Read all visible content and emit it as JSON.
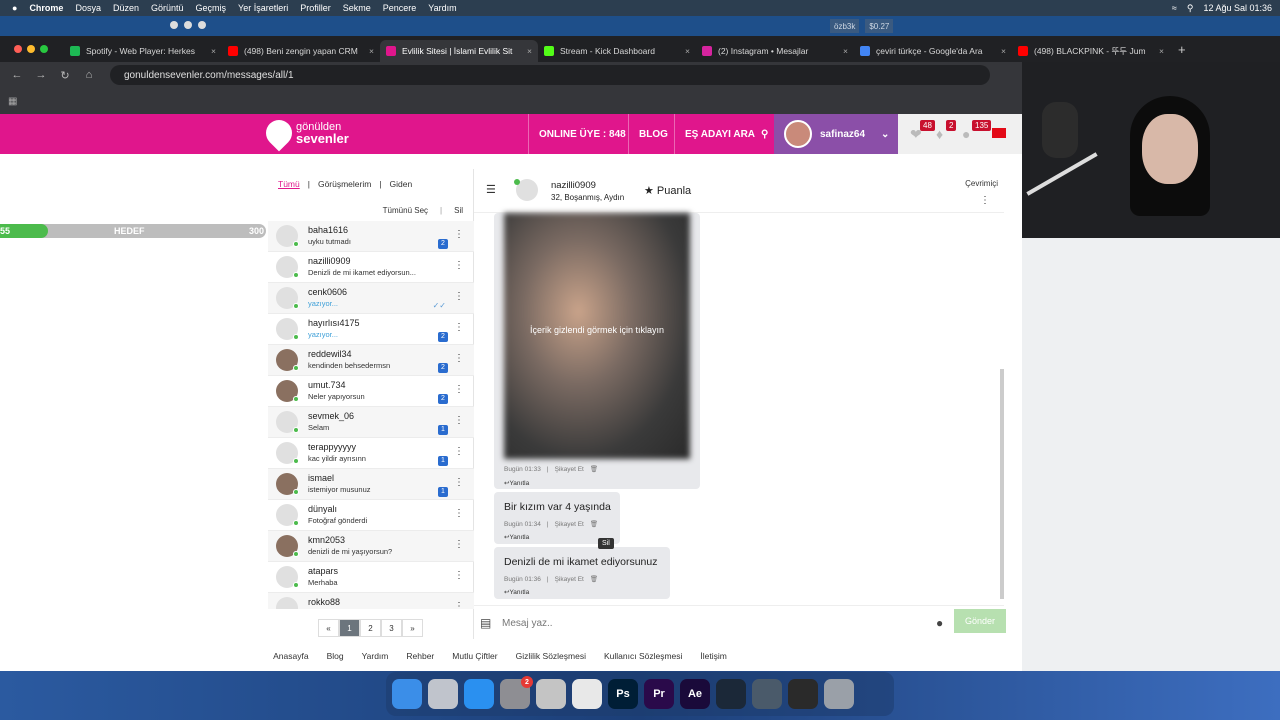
{
  "menubar": {
    "apple": "",
    "items": [
      "Chrome",
      "Dosya",
      "Düzen",
      "Görüntü",
      "Geçmiş",
      "Yer İşaretleri",
      "Profiller",
      "Sekme",
      "Pencere",
      "Yardım"
    ],
    "datetime": "12 Ağu Sal  01:36"
  },
  "strip": {
    "ticker": "özb3k",
    "price": "$0.27"
  },
  "tabs": [
    {
      "title": "Spotify - Web Player: Herkes",
      "color": "#1db954"
    },
    {
      "title": "(498) Beni zengin yapan CRM",
      "color": "#ff0000"
    },
    {
      "title": "Evlilik Sitesi | İslami Evlilik Sit",
      "color": "#e0168c",
      "active": true
    },
    {
      "title": "Stream - Kick Dashboard",
      "color": "#53fc18"
    },
    {
      "title": "(2) Instagram • Mesajlar",
      "color": "#d6249f"
    },
    {
      "title": "çeviri türkçe - Google'da Ara",
      "color": "#4285f4"
    },
    {
      "title": "(498) BLACKPINK - 뚜두 Jum",
      "color": "#ff0000"
    }
  ],
  "address": {
    "url": "gonuldensevenler.com/messages/all/1"
  },
  "site": {
    "logo_top": "gönülden",
    "logo_bottom": "sevenler",
    "online_label": "ONLINE ÜYE : 848",
    "blog": "BLOG",
    "search": "EŞ ADAYI ARA",
    "username": "safinaz64",
    "badges": [
      "48",
      "2",
      "135"
    ]
  },
  "progress": {
    "left": "55",
    "center": "HEDEF",
    "right": "300",
    "fraction": 0.18
  },
  "list": {
    "filters": [
      "Tümü",
      "Görüşmelerim",
      "Giden"
    ],
    "select_all": "Tümünü Seç",
    "delete": "Sil",
    "conversations": [
      {
        "name": "baha1616",
        "msg": "uyku tutmadı",
        "count": "2"
      },
      {
        "name": "nazilli0909",
        "msg": "Denizli de mi ikamet ediyorsun...",
        "count": ""
      },
      {
        "name": "cenk0606",
        "msg": "yazıyor...",
        "typing": true,
        "count": "",
        "read": true
      },
      {
        "name": "hayırlısı4175",
        "msg": "yazıyor...",
        "typing": true,
        "count": "2"
      },
      {
        "name": "reddewil34",
        "msg": "kendinden behsedermsn",
        "count": "2",
        "photo": true
      },
      {
        "name": "umut.734",
        "msg": "Neler yapıyorsun",
        "count": "2",
        "photo": true
      },
      {
        "name": "sevmek_06",
        "msg": "Selam",
        "count": "1"
      },
      {
        "name": "terappyyyyy",
        "msg": "kac yildir ayrısınn",
        "count": "1"
      },
      {
        "name": "ismael",
        "msg": "istemiyor musunuz",
        "count": "1",
        "photo": true
      },
      {
        "name": "dünyalı",
        "msg": "Fotoğraf gönderdi",
        "count": ""
      },
      {
        "name": "kmn2053",
        "msg": "denizli de mi yaşıyorsun?",
        "count": "",
        "photo": true
      },
      {
        "name": "atapars",
        "msg": "Merhaba",
        "count": ""
      },
      {
        "name": "rokko88",
        "msg": "...",
        "count": ""
      }
    ],
    "pages": [
      "«",
      "1",
      "2",
      "3",
      "»"
    ]
  },
  "chat": {
    "name": "nazilli0909",
    "sub": "32, Boşanmış, Aydın",
    "rate": "Puanla",
    "status": "Çevrimiçi",
    "hidden_text": "İçerik gizlendi görmek için tıklayın",
    "messages": [
      {
        "text": "",
        "time": "Bugün 01:33",
        "report": "Şikayet Et",
        "reply": "Yanıtla"
      },
      {
        "text": "Bir kızım var 4 yaşında",
        "time": "Bugün 01:34",
        "report": "Şikayet Et",
        "reply": "Yanıtla"
      },
      {
        "text": "Denizli de mi ikamet ediyorsunuz",
        "time": "Bugün 01:36",
        "report": "Şikayet Et",
        "reply": "Yanıtla"
      }
    ],
    "tooltip": "Sil",
    "placeholder": "Mesaj yaz..",
    "send": "Gönder"
  },
  "footer": [
    "Anasayfa",
    "Blog",
    "Yardım",
    "Rehber",
    "Mutlu Çiftler",
    "Gizlilik Sözleşmesi",
    "Kullanıcı Sözleşmesi",
    "İletişim"
  ],
  "dock": [
    {
      "name": "finder",
      "label": "",
      "color": "#3b8ee8"
    },
    {
      "name": "launchpad",
      "label": "",
      "color": "#c0c4cc"
    },
    {
      "name": "safari",
      "label": "",
      "color": "#2a90f0"
    },
    {
      "name": "system-settings",
      "label": "",
      "color": "#8e8e93",
      "badge": "2"
    },
    {
      "name": "other-app",
      "label": "",
      "color": "#c4c4c4"
    },
    {
      "name": "chrome",
      "label": "",
      "color": "#e8e8e8"
    },
    {
      "name": "photoshop",
      "label": "Ps",
      "color": "#001e36"
    },
    {
      "name": "premiere",
      "label": "Pr",
      "color": "#2a0a4a"
    },
    {
      "name": "after-effects",
      "label": "Ae",
      "color": "#1a0a3a"
    },
    {
      "name": "steam",
      "label": "",
      "color": "#1b2838"
    },
    {
      "name": "quicktime",
      "label": "",
      "color": "#4a5a6a"
    },
    {
      "name": "obs",
      "label": "",
      "color": "#2a2a2a"
    },
    {
      "name": "trash",
      "label": "",
      "color": "#9aa0a8"
    }
  ]
}
